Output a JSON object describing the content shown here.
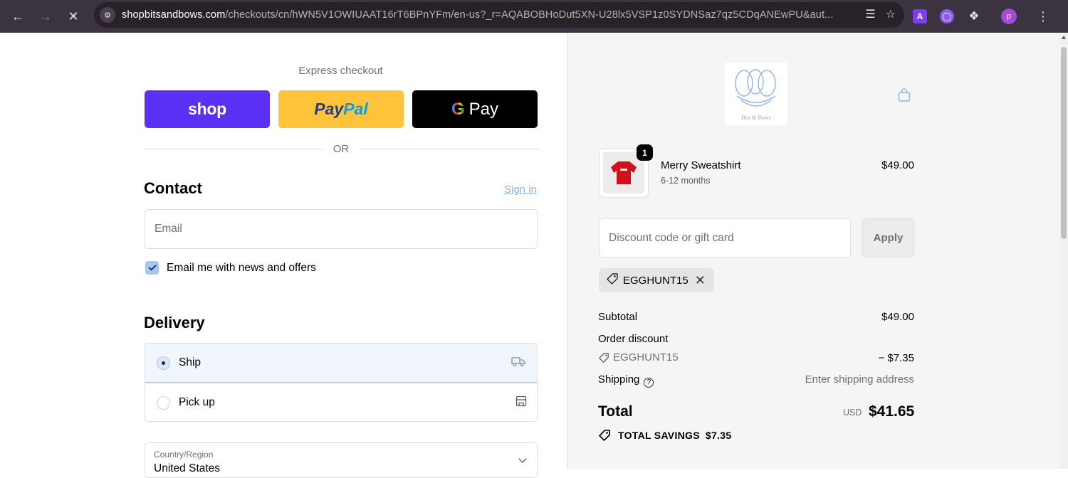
{
  "browser": {
    "url_host": "shopbitsandbows.com",
    "url_path": "/checkouts/cn/hWN5V1OWIUAAT16rT6BPnYFm/en-us?_r=AQABOBHoDut5XN-U28lx5VSP1z0SYDNSaz7qz5CDqANEwPU&aut...",
    "profile_initial": "p",
    "ext_a_label": "A"
  },
  "express": {
    "title": "Express checkout",
    "shop_label": "shop",
    "paypal_part1": "Pay",
    "paypal_part2": "Pal",
    "gpay_g": "G",
    "gpay_label": "Pay",
    "or_label": "OR"
  },
  "contact": {
    "heading": "Contact",
    "sign_in": "Sign in",
    "email_placeholder": "Email",
    "news_label": "Email me with news and offers",
    "news_checked": true
  },
  "delivery": {
    "heading": "Delivery",
    "options": [
      {
        "label": "Ship",
        "selected": true,
        "icon": "truck-icon"
      },
      {
        "label": "Pick up",
        "selected": false,
        "icon": "store-icon"
      }
    ],
    "country_label": "Country/Region",
    "country_value": "United States"
  },
  "summary": {
    "logo_text": "Bits & Bows",
    "item": {
      "name": "Merry Sweatshirt",
      "variant": "6-12 months",
      "price": "$49.00",
      "quantity": "1",
      "color": "#d0111c"
    },
    "discount_placeholder": "Discount code or gift card",
    "apply_label": "Apply",
    "applied_code": "EGGHUNT15",
    "subtotal_label": "Subtotal",
    "subtotal_value": "$49.00",
    "order_discount_label": "Order discount",
    "discount_code": "EGGHUNT15",
    "discount_value": "− $7.35",
    "shipping_label": "Shipping",
    "shipping_value": "Enter shipping address",
    "total_label": "Total",
    "currency": "USD",
    "total_value": "$41.65",
    "savings_label": "TOTAL SAVINGS",
    "savings_value": "$7.35"
  },
  "colors": {
    "shop_purple": "#5a31f4",
    "paypal_yellow": "#ffc439",
    "accent_blue": "#a8c6ee"
  }
}
